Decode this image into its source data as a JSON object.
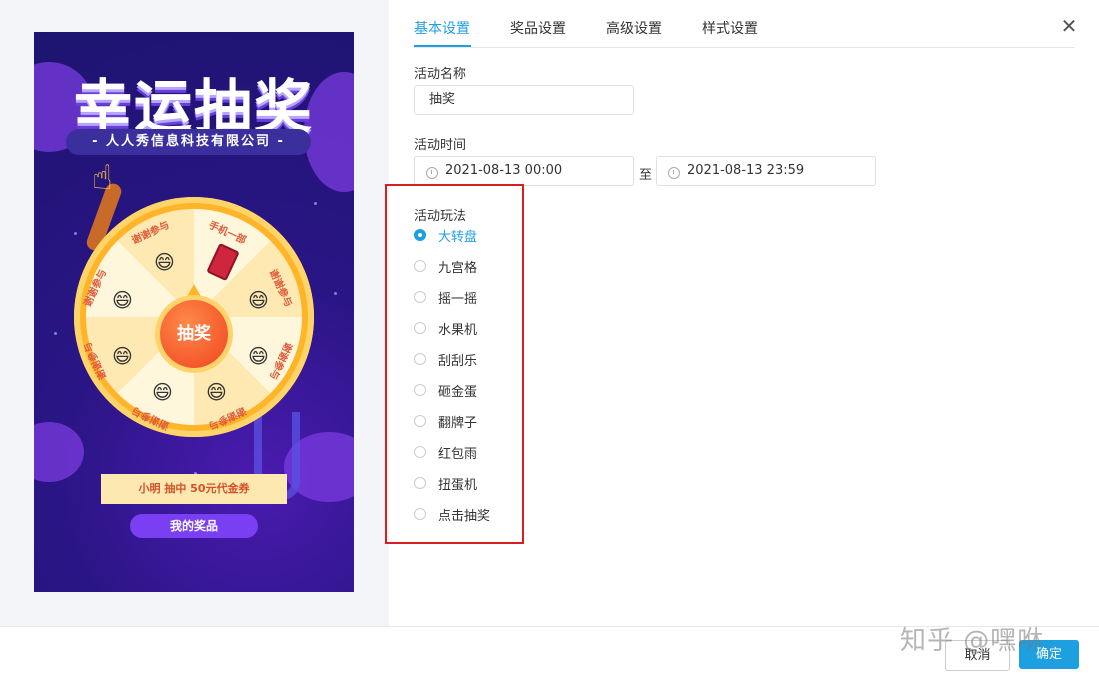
{
  "preview": {
    "title": "幸运抽奖",
    "company": "- 人人秀信息科技有限公司 -",
    "segments": [
      "谢谢参与",
      "手机一部",
      "谢谢参与",
      "谢谢参与",
      "谢谢参与",
      "谢谢参与",
      "谢谢参与",
      "谢谢参与"
    ],
    "center_button": "抽奖",
    "winner_text": "小明  抽中  50元代金券",
    "my_prize_button": "我的奖品"
  },
  "tabs": [
    "基本设置",
    "奖品设置",
    "高级设置",
    "样式设置"
  ],
  "active_tab": "基本设置",
  "form": {
    "name_label": "活动名称",
    "name_value": "抽奖",
    "time_label": "活动时间",
    "start_time": "2021-08-13 00:00",
    "to_text": "至",
    "end_time": "2021-08-13 23:59",
    "mode_label": "活动玩法",
    "modes": [
      "大转盘",
      "九宫格",
      "摇一摇",
      "水果机",
      "刮刮乐",
      "砸金蛋",
      "翻牌子",
      "红包雨",
      "扭蛋机",
      "点击抽奖"
    ],
    "selected_mode": "大转盘"
  },
  "footer": {
    "cancel": "取消",
    "ok": "确定"
  },
  "watermark": "知乎 @嘿咻",
  "colors": {
    "accent": "#1e9fe0",
    "highlight": "#d81e1e",
    "poster_bg": "#2a1585"
  },
  "icons": [
    "close-icon",
    "clock-icon",
    "pointing-hand-icon",
    "smile-icon",
    "phone-icon"
  ]
}
